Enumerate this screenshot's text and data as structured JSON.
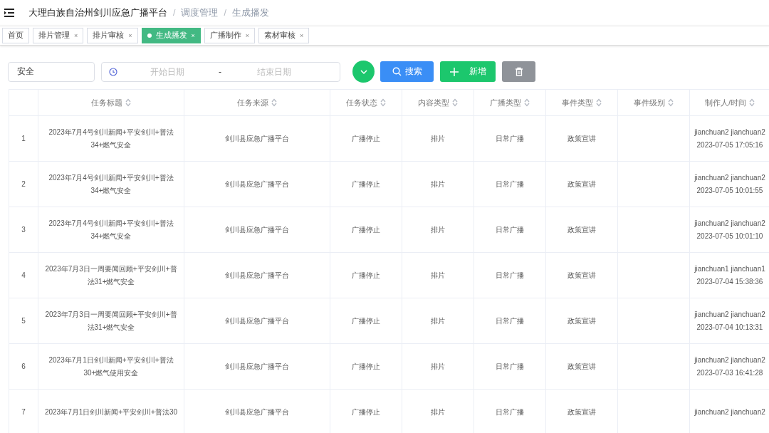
{
  "header": {
    "breadcrumb": [
      "大理白族自治州剑川应急广播平台",
      "调度管理",
      "生成播发"
    ],
    "separator": "/"
  },
  "tabs": [
    {
      "label": "首页",
      "selected": false
    },
    {
      "label": "排片管理",
      "selected": false,
      "close": "×"
    },
    {
      "label": "排片审核",
      "selected": false,
      "close": "×"
    },
    {
      "label": "生成播发",
      "selected": true,
      "close": "×"
    },
    {
      "label": "广播制作",
      "selected": false,
      "close": "×"
    },
    {
      "label": "素材审核",
      "selected": false,
      "close": "×"
    }
  ],
  "filters": {
    "keyword": {
      "value": "安全"
    },
    "date_range": {
      "start_placeholder": "开始日期",
      "separator": "-",
      "end_placeholder": "结束日期"
    },
    "search_button": "搜索",
    "add_button": "新增"
  },
  "table": {
    "columns": [
      "",
      "任务标题",
      "任务来源",
      "任务状态",
      "内容类型",
      "广播类型",
      "事件类型",
      "事件级别",
      "制作人/时间"
    ],
    "rows": [
      {
        "index": "1",
        "title": "2023年7月4号剑川新闻+平安剑川+普法34+燃气安全",
        "source": "剑川县应急广播平台",
        "status": "广播停止",
        "content_type": "排片",
        "broadcast_type": "日常广播",
        "event_type": "政策宣讲",
        "event_level": "",
        "maker": "jianchuan2 jianchuan2",
        "time": "2023-07-05 17:05:16"
      },
      {
        "index": "2",
        "title": "2023年7月4号剑川新闻+平安剑川+普法34+燃气安全",
        "source": "剑川县应急广播平台",
        "status": "广播停止",
        "content_type": "排片",
        "broadcast_type": "日常广播",
        "event_type": "政策宣讲",
        "event_level": "",
        "maker": "jianchuan2 jianchuan2",
        "time": "2023-07-05 10:01:55"
      },
      {
        "index": "3",
        "title": "2023年7月4号剑川新闻+平安剑川+普法34+燃气安全",
        "source": "剑川县应急广播平台",
        "status": "广播停止",
        "content_type": "排片",
        "broadcast_type": "日常广播",
        "event_type": "政策宣讲",
        "event_level": "",
        "maker": "jianchuan2 jianchuan2",
        "time": "2023-07-05 10:01:10"
      },
      {
        "index": "4",
        "title": "2023年7月3日一周要闻回顾+平安剑川+普法31+燃气安全",
        "source": "剑川县应急广播平台",
        "status": "广播停止",
        "content_type": "排片",
        "broadcast_type": "日常广播",
        "event_type": "政策宣讲",
        "event_level": "",
        "maker": "jianchuan1 jianchuan1",
        "time": "2023-07-04 15:38:36"
      },
      {
        "index": "5",
        "title": "2023年7月3日一周要闻回顾+平安剑川+普法31+燃气安全",
        "source": "剑川县应急广播平台",
        "status": "广播停止",
        "content_type": "排片",
        "broadcast_type": "日常广播",
        "event_type": "政策宣讲",
        "event_level": "",
        "maker": "jianchuan2 jianchuan2",
        "time": "2023-07-04 10:13:31"
      },
      {
        "index": "6",
        "title": "2023年7月1日剑川新闻+平安剑川+普法30+燃气使用安全",
        "source": "剑川县应急广播平台",
        "status": "广播停止",
        "content_type": "排片",
        "broadcast_type": "日常广播",
        "event_type": "政策宣讲",
        "event_level": "",
        "maker": "jianchuan2 jianchuan2",
        "time": "2023-07-03 16:41:28"
      },
      {
        "index": "7",
        "title": "2023年7月1日剑川新闻+平安剑川+普法30",
        "source": "剑川县应急广播平台",
        "status": "广播停止",
        "content_type": "排片",
        "broadcast_type": "日常广播",
        "event_type": "政策宣讲",
        "event_level": "",
        "maker": "jianchuan2 jianchuan2",
        "time": ""
      }
    ]
  }
}
